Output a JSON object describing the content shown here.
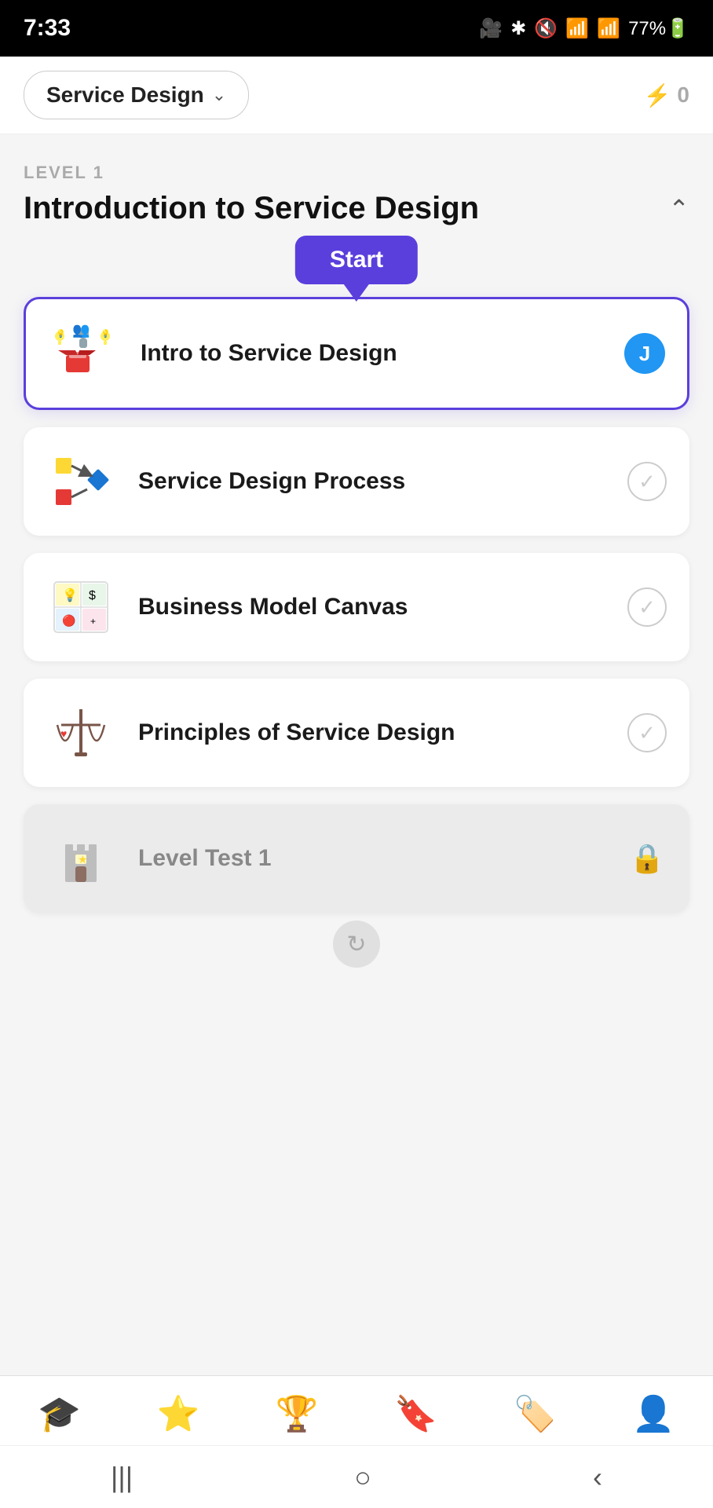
{
  "statusBar": {
    "time": "7:33",
    "icons": "🎥 * 🔇 📶 77%🔋"
  },
  "header": {
    "courseLabel": "Service Design",
    "chevron": "∨",
    "lightning": "⚡",
    "score": "0"
  },
  "level": {
    "label": "LEVEL 1",
    "title": "Introduction to Service Design",
    "collapseIcon": "∧"
  },
  "tooltip": {
    "label": "Start"
  },
  "lessons": [
    {
      "id": "intro",
      "name": "Intro to Service Design",
      "status": "active",
      "avatar": "J"
    },
    {
      "id": "process",
      "name": "Service Design Process",
      "status": "check"
    },
    {
      "id": "canvas",
      "name": "Business Model Canvas",
      "status": "check"
    },
    {
      "id": "principles",
      "name": "Principles of Service Design",
      "status": "check"
    },
    {
      "id": "test",
      "name": "Level Test 1",
      "status": "locked"
    }
  ],
  "bottomNav": {
    "items": [
      {
        "id": "home",
        "icon": "🎓",
        "active": true
      },
      {
        "id": "stars",
        "icon": "⭐",
        "active": false
      },
      {
        "id": "trophy",
        "icon": "🏆",
        "active": false
      },
      {
        "id": "bookmark",
        "icon": "🔖",
        "active": false
      },
      {
        "id": "tag",
        "icon": "🏷️",
        "active": false
      },
      {
        "id": "profile",
        "icon": "👤",
        "active": false
      }
    ]
  },
  "systemNav": {
    "menu": "|||",
    "home": "○",
    "back": "‹"
  }
}
